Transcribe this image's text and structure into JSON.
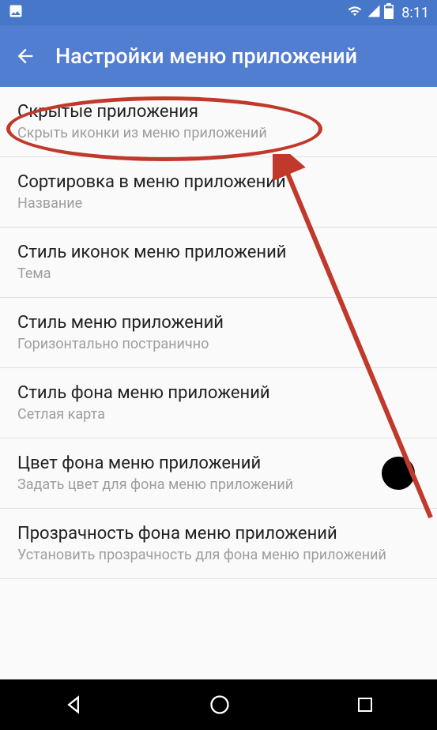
{
  "statusBar": {
    "time": "8:11"
  },
  "appBar": {
    "title": "Настройки меню приложений"
  },
  "settings": [
    {
      "title": "Скрытые приложения",
      "subtitle": "Скрыть иконки из меню приложений"
    },
    {
      "title": "Сортировка в меню приложений",
      "subtitle": "Название"
    },
    {
      "title": "Стиль иконок меню приложений",
      "subtitle": "Тема"
    },
    {
      "title": "Стиль меню приложений",
      "subtitle": "Горизонтально постранично"
    },
    {
      "title": "Стиль фона меню приложений",
      "subtitle": "Сетлая карта"
    },
    {
      "title": "Цвет фона меню приложений",
      "subtitle": "Задать цвет для фона меню приложений"
    },
    {
      "title": "Прозрачность фона меню приложений",
      "subtitle": "Установить прозрачность для фона меню приложений"
    }
  ]
}
